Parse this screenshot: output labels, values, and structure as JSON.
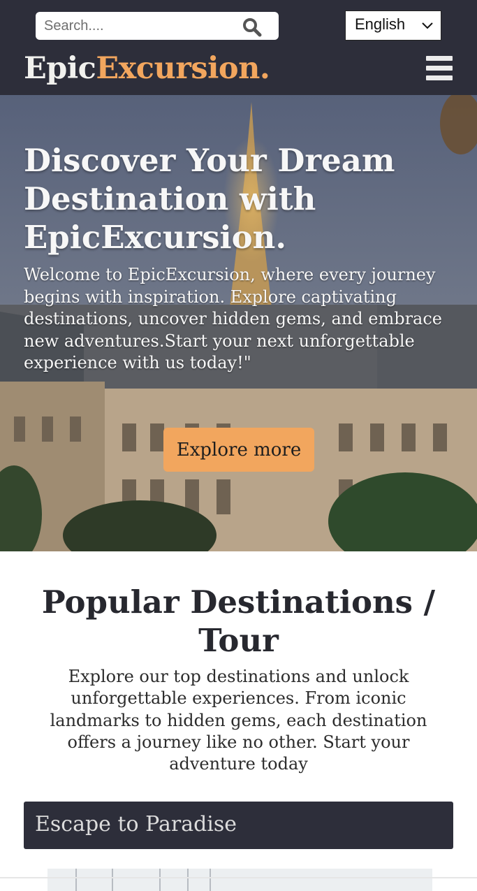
{
  "header": {
    "search": {
      "placeholder": "Search....",
      "value": ""
    },
    "language": {
      "selected": "English"
    },
    "logo": {
      "part1": "Epic",
      "part2": "Excursion."
    }
  },
  "hero": {
    "title": "Discover Your Dream Destination with EpicExcursion.",
    "text": "Welcome to EpicExcursion, where every journey begins with inspiration. Explore captivating destinations, uncover hidden gems, and embrace new adventures.Start your next unforgettable experience with us today!\"",
    "button_label": "Explore more"
  },
  "destinations": {
    "title": "Popular Destinations / Tour",
    "text": "Explore our top destinations and unlock unforgettable experiences. From iconic landmarks to hidden gems, each destination offers a journey like no other. Start your adventure today",
    "cards": [
      {
        "title": "Escape to Paradise"
      }
    ]
  },
  "colors": {
    "header_bg": "#2d2e3a",
    "accent": "#f2a65e",
    "logo_light": "#f1f1ee",
    "text_dark": "#27282f"
  },
  "icons": [
    "search-icon",
    "chevron-down-icon",
    "menu-icon"
  ]
}
